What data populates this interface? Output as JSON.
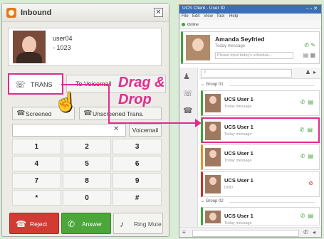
{
  "inbound": {
    "title": "Inbound",
    "close": "✕",
    "caller_name": "user04",
    "caller_ext": "- 1023",
    "trans_label": "TRANS",
    "voicemail_label": "To Voicemail",
    "screened_label": "Screened",
    "unscreened_label": "Unscreened Trans.",
    "number_value": "",
    "clear_glyph": "✕",
    "voicemail2_label": "Voicemail",
    "keys": [
      "1",
      "2",
      "3",
      "4",
      "5",
      "6",
      "7",
      "8",
      "9",
      "*",
      "0",
      "#"
    ],
    "reject_label": "Reject",
    "answer_label": "Answer",
    "mute_label": "Ring Mute"
  },
  "annotation": {
    "line1": "Drag &",
    "line2": "Drop"
  },
  "ucs": {
    "title": "UCS Client - User ID",
    "menu": [
      "File",
      "Edit",
      "View",
      "Tool",
      "Help"
    ],
    "status": "Online",
    "me_name": "Amanda Seyfried",
    "me_msg": "Today message",
    "me_input_placeholder": "Please input today's schedule...",
    "search_placeholder": "",
    "group1": "Group 01",
    "group2": "Group 02",
    "contacts": [
      {
        "name": "UCS User 1",
        "msg": "Today message"
      },
      {
        "name": "UCS User 1",
        "msg": "Today message"
      },
      {
        "name": "UCS User 1",
        "msg": "Today message"
      },
      {
        "name": "UCS User 1",
        "msg": "DND"
      },
      {
        "name": "UCS User 1",
        "msg": "Today message"
      },
      {
        "name": "UCS User 1",
        "msg": "Today message"
      }
    ]
  },
  "colors": {
    "accent": "#e12b8f",
    "online": "#43a43b",
    "reject": "#d23b34",
    "answer": "#4da63c",
    "title_bar": "#3a6fb7"
  }
}
